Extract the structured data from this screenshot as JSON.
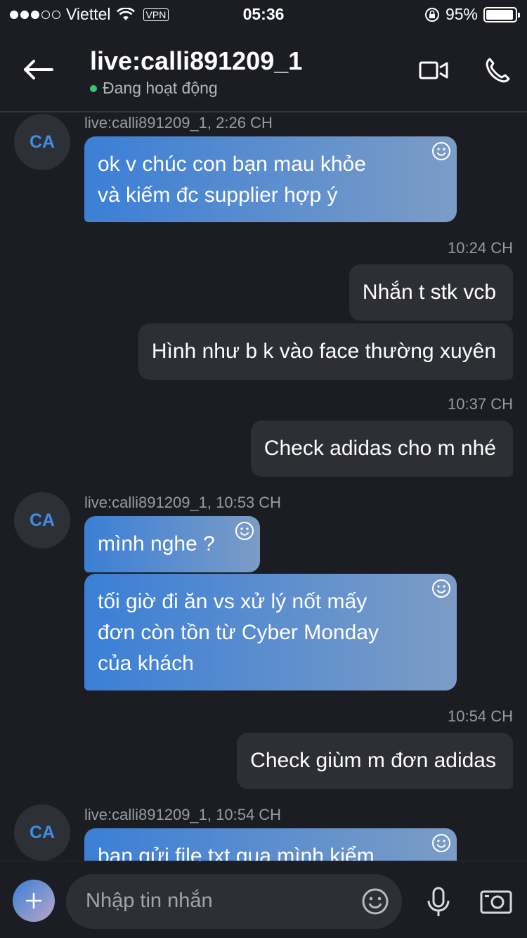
{
  "status_bar": {
    "carrier": "Viettel",
    "vpn": "VPN",
    "time": "05:36",
    "battery": "95%",
    "battery_level": 0.95
  },
  "header": {
    "title": "live:calli891209_1",
    "presence": "Đang hoạt động"
  },
  "messages": {
    "group1": {
      "avatar": "CA",
      "meta": "live:calli891209_1, 2:26 CH",
      "bubble1": [
        "ok v chúc con bạn mau khỏe",
        "và kiếm đc supplier hợp ý"
      ]
    },
    "time1": "10:24 CH",
    "out1": "Nhắn t stk vcb",
    "out2": "Hình như b k vào face thường xuyên",
    "time2": "10:37 CH",
    "out3": "Check adidas cho m nhé",
    "group2": {
      "avatar": "CA",
      "meta": "live:calli891209_1, 10:53 CH",
      "bubble1": "mình nghe ?",
      "bubble2": [
        "tối giờ đi ăn vs xử lý nốt mấy",
        "đơn còn tồn từ Cyber Monday",
        "của khách"
      ]
    },
    "time3": "10:54 CH",
    "out4": "Check giùm m đơn adidas",
    "group3": {
      "avatar": "CA",
      "meta": "live:calli891209_1, 10:54 CH",
      "bubble1": "bạn gửi file txt qua mình kiểm"
    }
  },
  "composer": {
    "placeholder": "Nhập tin nhắn"
  },
  "colors": {
    "background": "#1c1d22",
    "accent": "#3d8ee6",
    "presence": "#35c86b",
    "outgoing_bubble": "#2e2f35"
  }
}
